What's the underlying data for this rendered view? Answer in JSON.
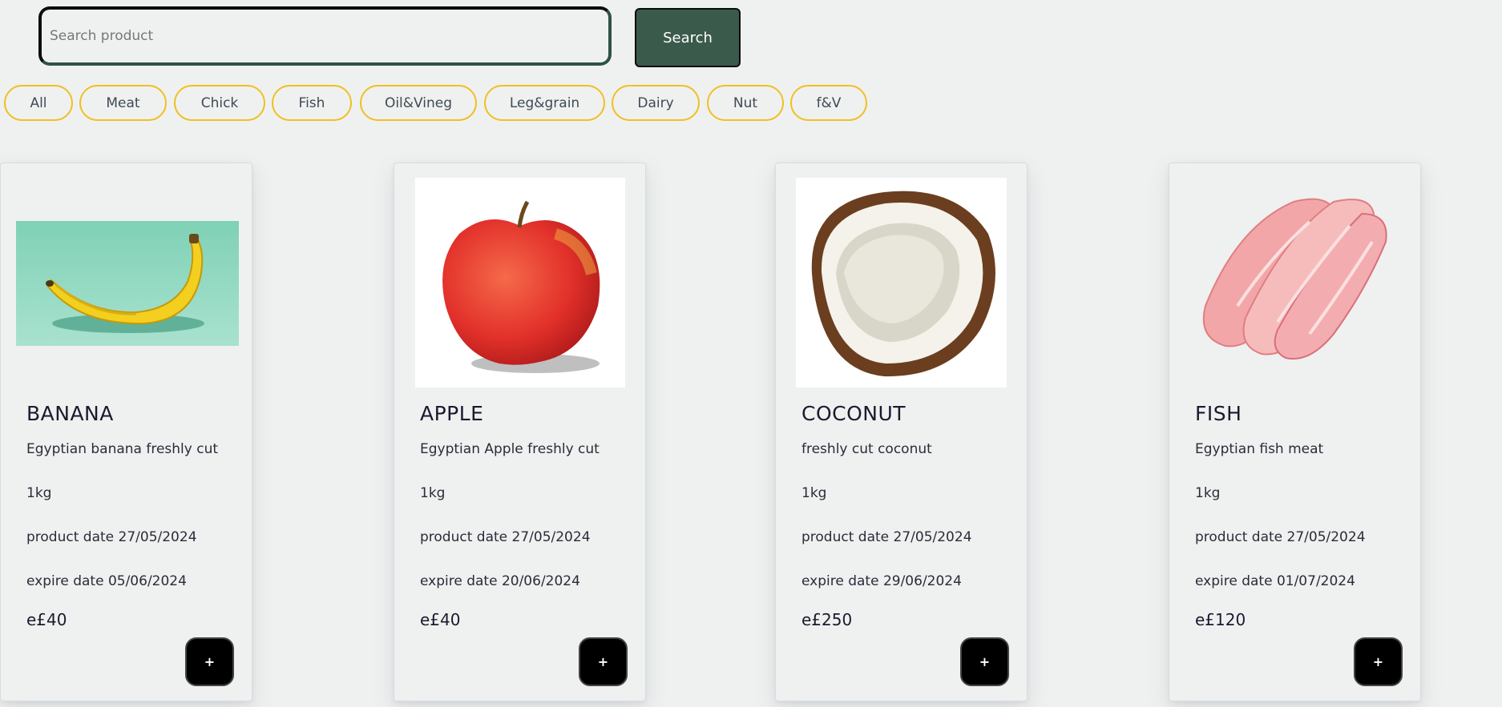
{
  "search": {
    "placeholder": "Search product",
    "value": "",
    "button_label": "Search"
  },
  "colors": {
    "accent": "#3a5a4c",
    "filter_border": "#f0c024",
    "background": "#eff1f0",
    "add_button": "#000000"
  },
  "filters": [
    {
      "label": "All"
    },
    {
      "label": "Meat"
    },
    {
      "label": "Chick"
    },
    {
      "label": "Fish"
    },
    {
      "label": "Oil&Vineg"
    },
    {
      "label": "Leg&grain"
    },
    {
      "label": "Dairy"
    },
    {
      "label": "Nut"
    },
    {
      "label": "f&V"
    }
  ],
  "products": [
    {
      "name": "BANANA",
      "description": "Egyptian banana freshly cut",
      "weight": "1kg",
      "product_date": "product date 27/05/2024",
      "expire_date": "expire date 05/06/2024",
      "price": "e£40",
      "add_label": "+",
      "image": "banana-image"
    },
    {
      "name": "APPLE",
      "description": "Egyptian Apple freshly cut",
      "weight": "1kg",
      "product_date": "product date 27/05/2024",
      "expire_date": "expire date 20/06/2024",
      "price": "e£40",
      "add_label": "+",
      "image": "apple-image"
    },
    {
      "name": "COCONUT",
      "description": "freshly cut coconut",
      "weight": "1kg",
      "product_date": "product date 27/05/2024",
      "expire_date": "expire date 29/06/2024",
      "price": "e£250",
      "add_label": "+",
      "image": "coconut-image"
    },
    {
      "name": "FISH",
      "description": "Egyptian fish meat",
      "weight": "1kg",
      "product_date": "product date 27/05/2024",
      "expire_date": "expire date 01/07/2024",
      "price": "e£120",
      "add_label": "+",
      "image": "fish-image"
    }
  ]
}
